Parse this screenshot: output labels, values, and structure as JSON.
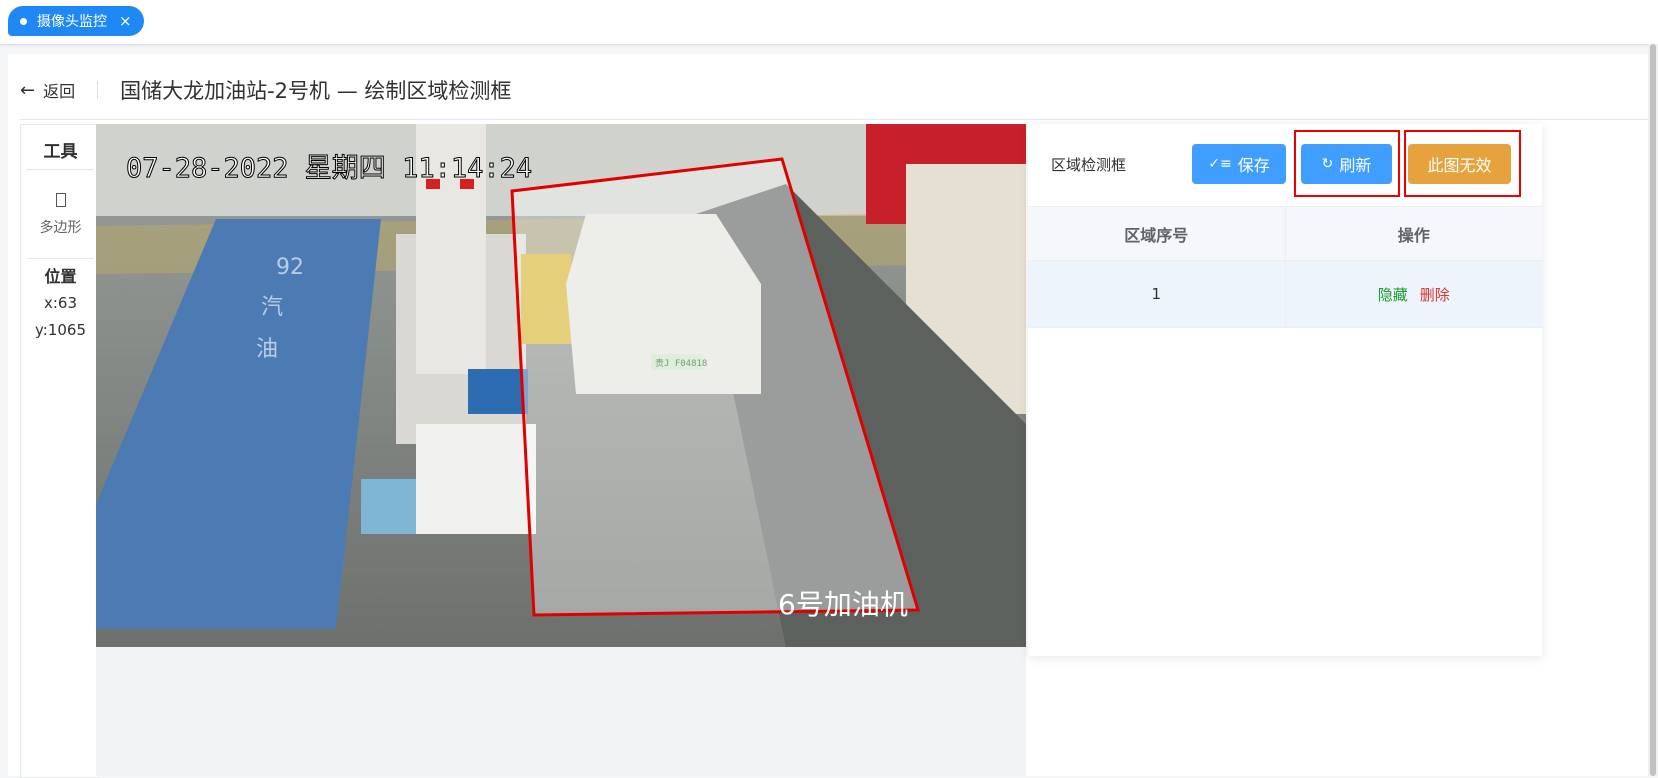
{
  "tab": {
    "label": "摄像头监控",
    "close": "×"
  },
  "header": {
    "back_label": "返回",
    "title": "国储大龙加油站-2号机 — 绘制区域检测框"
  },
  "tools": {
    "title": "工具",
    "polygon_label": "多边形",
    "position_title": "位置",
    "x_text": "x:63",
    "y_text": "y:1065"
  },
  "camera": {
    "timestamp": "07-28-2022 星期四 11:14:24",
    "overlay_label": "6号加油机",
    "plate": "贵J F04818",
    "pump_marks": [
      "92",
      "汽",
      "油"
    ]
  },
  "panel": {
    "label": "区域检测框",
    "save_label": "保存",
    "refresh_label": "刷新",
    "invalid_label": "此图无效",
    "columns": [
      "区域序号",
      "操作"
    ],
    "rows": [
      {
        "index": "1",
        "hide": "隐藏",
        "delete": "删除"
      }
    ]
  },
  "colors": {
    "primary": "#409eff",
    "warning": "#e6a23c",
    "tab": "#1e88f5",
    "region": "#e00000"
  }
}
